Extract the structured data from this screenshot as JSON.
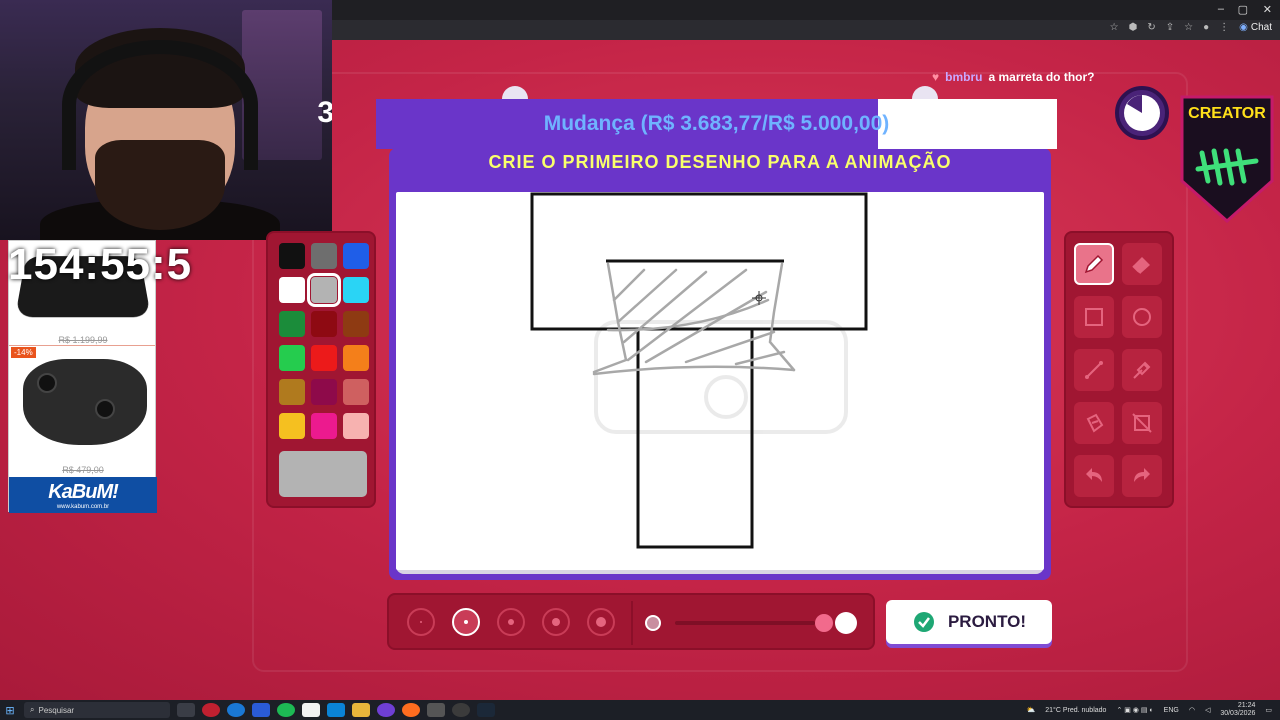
{
  "window": {
    "minimize": "–",
    "maximize": "▢",
    "close": "✕",
    "chat_label": "Chat"
  },
  "webcam": {
    "overlay_number": "3"
  },
  "stream": {
    "timer": "154:55:5",
    "goal_text": "Mudança (R$ 3.683,77/R$ 5.000,00)",
    "goal_progress": 0.737,
    "chat": {
      "user": "bmbru",
      "message": "a marreta do thor?"
    },
    "badge_label": "CREATOR"
  },
  "ad": {
    "product1_price": "R$ 1.199,99",
    "product2_badge": "-14%",
    "product2_price": "R$ 479,00",
    "brand": "KaBuM!",
    "url": "www.kabum.com.br"
  },
  "game": {
    "instruction": "CRIE O PRIMEIRO DESENHO PARA A ANIMAÇÃO",
    "ready_label": "PRONTO!",
    "palette": [
      "#111111",
      "#6e6e6e",
      "#1f5ee8",
      "#ffffff",
      "#b3b3b3",
      "#2ad4f5",
      "#1b8c3a",
      "#8e0a12",
      "#8e3a12",
      "#25cc4e",
      "#ec1a1a",
      "#f47f1a",
      "#b07a1e",
      "#8e0a4a",
      "#cf6060",
      "#f5c020",
      "#ec1a8e",
      "#f7b2b0"
    ],
    "selected_color": "#b3b3b3",
    "tools": [
      "pencil-tool",
      "eraser-tool",
      "rectangle-tool",
      "ellipse-tool",
      "line-tool",
      "eyedropper-tool",
      "fill-tool",
      "clear-tool",
      "undo-tool",
      "redo-tool"
    ],
    "active_tool": "pencil-tool",
    "brush_sizes": 5,
    "active_brush_size": 2,
    "opacity_fraction": 1.0
  },
  "taskbar": {
    "search_placeholder": "Pesquisar",
    "weather": "21°C  Pred. nublado",
    "lang": "ENG",
    "time": "21:24",
    "date": "30/03/2026"
  }
}
